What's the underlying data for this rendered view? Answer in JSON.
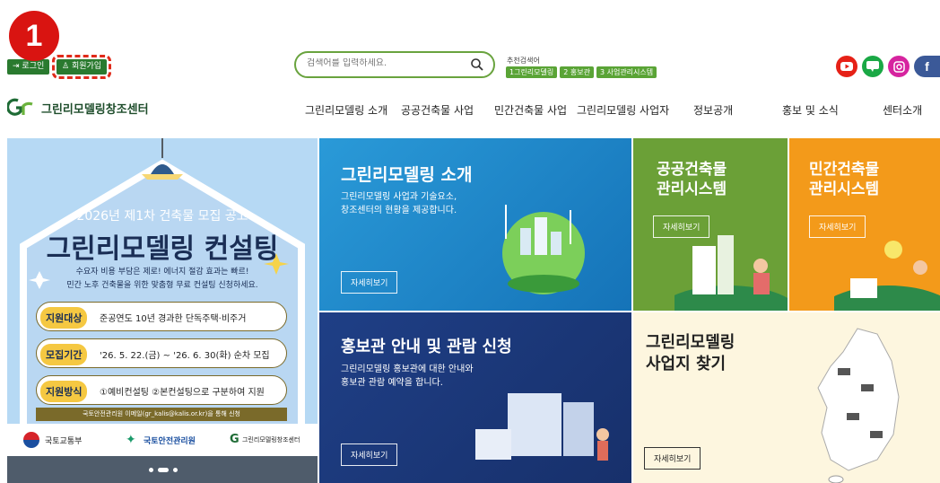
{
  "marker": {
    "number": "1"
  },
  "header": {
    "login_label": "로그인",
    "join_label": "회원가입",
    "search": {
      "placeholder": "검색어를 입력하세요."
    },
    "recommend": {
      "title": "추천검색어",
      "tags": [
        "1그린리모델링",
        "2 홍보관",
        "3 사업관리시스템"
      ]
    },
    "social": [
      {
        "icon": "youtube-icon",
        "color": "#e62117"
      },
      {
        "icon": "blog-icon",
        "color": "#1aa845"
      },
      {
        "icon": "instagram-icon",
        "color": "#d6249f"
      },
      {
        "icon": "facebook-icon",
        "color": "#3b5998"
      }
    ]
  },
  "logo": {
    "mark": "GR",
    "text": "그린리모델링창조센터"
  },
  "nav": {
    "items": [
      "그린리모델링 소개",
      "공공건축물 사업",
      "민간건축물 사업",
      "그린리모델링 사업자",
      "정보공개",
      "홍보 및 소식",
      "센터소개"
    ]
  },
  "hero": {
    "notice": "2026년 제1차 건축물 모집 공고",
    "headline": "그린리모델링 컨설팅",
    "sub1": "수요자 비용 부담은 제로! 에너지 절감 효과는 빠르!",
    "sub2": "민간 노후 건축물을 위한 맞춤형 무료 컨설팅 신청하세요.",
    "rows": [
      {
        "label": "지원대상",
        "value": "준공연도 10년 경과한 단독주택·비주거"
      },
      {
        "label": "모집기간",
        "value": "'26. 5. 22.(금) ~ '26. 6. 30(화) 순차 모집"
      },
      {
        "label": "지원방식",
        "value": "①예비컨설팅 ②본컨설팅으로 구분하여 지원"
      }
    ],
    "footnote": "국토안전관리원 이메일(gr_kalis@kalis.or.kr)을 통해 신청",
    "orgs": [
      "국토교통부",
      "국토안전관리원",
      "그린리모델링창조센터"
    ]
  },
  "panels": {
    "intro": {
      "title": "그린리모델링 소개",
      "desc": "그린리모델링 사업과 기술요소,\n창조센터의 현황을 제공합니다.",
      "more": "자세히보기"
    },
    "public": {
      "title": "공공건축물\n관리시스템",
      "more": "자세히보기"
    },
    "private": {
      "title": "민간건축물\n관리시스템",
      "more": "자세히보기"
    },
    "promo": {
      "title": "홍보관 안내 및 관람 신청",
      "desc": "그린리모델링 홍보관에 대한 안내와\n홍보관 관람 예약을 합니다.",
      "more": "자세히보기"
    },
    "map": {
      "title": "그린리모델링\n사업지 찾기",
      "more": "자세히보기"
    }
  }
}
